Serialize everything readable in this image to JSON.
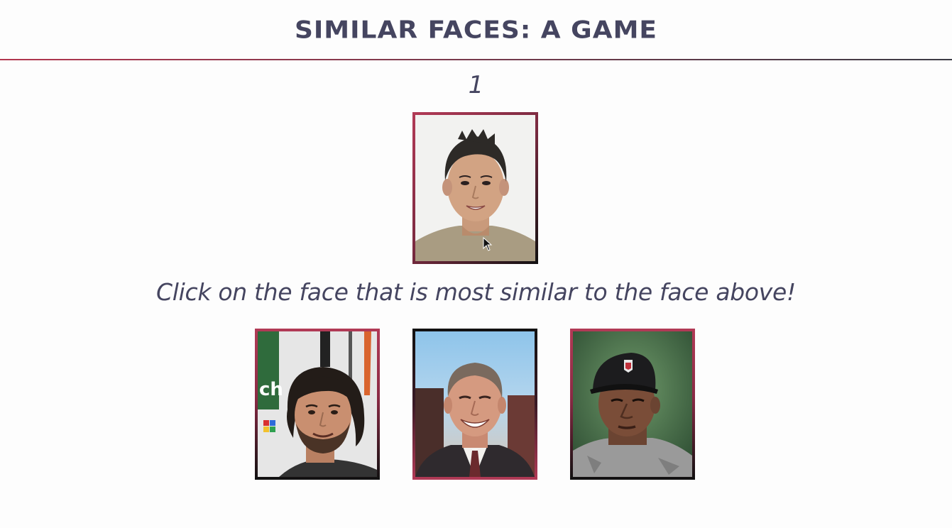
{
  "header": {
    "title": "SIMILAR FACES: A GAME"
  },
  "round": {
    "number": "1"
  },
  "target_face": {
    "label": "target-face"
  },
  "instructions": {
    "text": "Click on the face that is most similar to the face above!"
  },
  "choices": [
    {
      "id": "choice-1"
    },
    {
      "id": "choice-2"
    },
    {
      "id": "choice-3"
    }
  ],
  "colors": {
    "title": "#454560",
    "accent": "#b23a56",
    "dark": "#111111",
    "background": "#fdfdfd"
  }
}
